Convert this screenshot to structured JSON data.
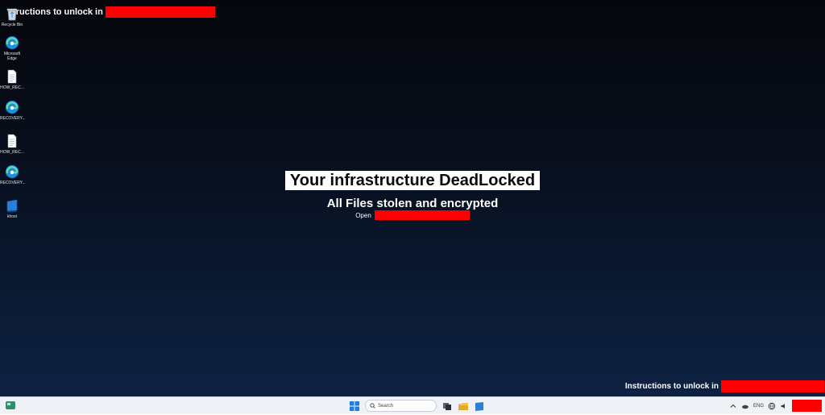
{
  "desktop": {
    "top_instructions": "tructions to unlock in",
    "headline": "Your infrastructure DeadLocked",
    "subline": "All Files stolen and encrypted",
    "open_label": "Open",
    "bottom_instructions": "Instructions to unlock in",
    "icons": [
      {
        "label": "Recycle Bin",
        "icon": "recycle-bin-icon"
      },
      {
        "label": "Microsoft Edge",
        "icon": "edge-icon"
      },
      {
        "label": "HOW_REC...",
        "icon": "text-file-icon"
      },
      {
        "label": "RECOVERY...",
        "icon": "edge-icon"
      },
      {
        "label": "HOW_REC...",
        "icon": "text-file-icon"
      },
      {
        "label": "RECOVERY...",
        "icon": "edge-icon"
      },
      {
        "label": "khost",
        "icon": "blue-tile-icon"
      }
    ]
  },
  "taskbar": {
    "search_placeholder": "Search",
    "language": "ENG"
  },
  "colors": {
    "redaction": "#ff0000",
    "background_top": "#05070c",
    "background_bottom": "#0e2142",
    "taskbar": "#eef1f6"
  }
}
